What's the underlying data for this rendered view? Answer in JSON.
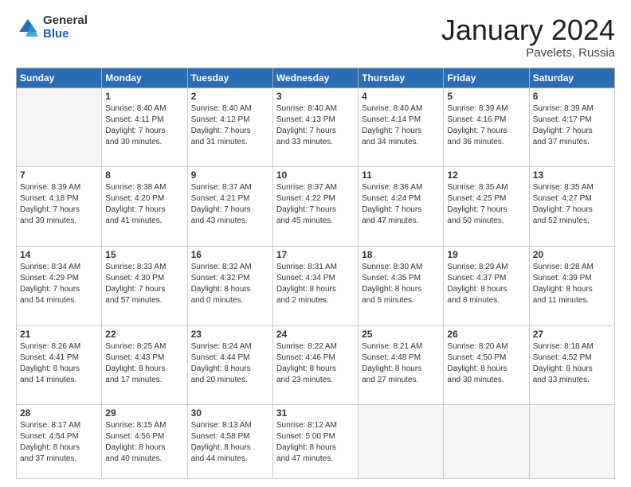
{
  "logo": {
    "general": "General",
    "blue": "Blue"
  },
  "title": "January 2024",
  "location": "Pavelets, Russia",
  "days_header": [
    "Sunday",
    "Monday",
    "Tuesday",
    "Wednesday",
    "Thursday",
    "Friday",
    "Saturday"
  ],
  "weeks": [
    [
      {
        "day": "",
        "content": ""
      },
      {
        "day": "1",
        "content": "Sunrise: 8:40 AM\nSunset: 4:11 PM\nDaylight: 7 hours\nand 30 minutes."
      },
      {
        "day": "2",
        "content": "Sunrise: 8:40 AM\nSunset: 4:12 PM\nDaylight: 7 hours\nand 31 minutes."
      },
      {
        "day": "3",
        "content": "Sunrise: 8:40 AM\nSunset: 4:13 PM\nDaylight: 7 hours\nand 33 minutes."
      },
      {
        "day": "4",
        "content": "Sunrise: 8:40 AM\nSunset: 4:14 PM\nDaylight: 7 hours\nand 34 minutes."
      },
      {
        "day": "5",
        "content": "Sunrise: 8:39 AM\nSunset: 4:16 PM\nDaylight: 7 hours\nand 36 minutes."
      },
      {
        "day": "6",
        "content": "Sunrise: 8:39 AM\nSunset: 4:17 PM\nDaylight: 7 hours\nand 37 minutes."
      }
    ],
    [
      {
        "day": "7",
        "content": "Sunrise: 8:39 AM\nSunset: 4:18 PM\nDaylight: 7 hours\nand 39 minutes."
      },
      {
        "day": "8",
        "content": "Sunrise: 8:38 AM\nSunset: 4:20 PM\nDaylight: 7 hours\nand 41 minutes."
      },
      {
        "day": "9",
        "content": "Sunrise: 8:37 AM\nSunset: 4:21 PM\nDaylight: 7 hours\nand 43 minutes."
      },
      {
        "day": "10",
        "content": "Sunrise: 8:37 AM\nSunset: 4:22 PM\nDaylight: 7 hours\nand 45 minutes."
      },
      {
        "day": "11",
        "content": "Sunrise: 8:36 AM\nSunset: 4:24 PM\nDaylight: 7 hours\nand 47 minutes."
      },
      {
        "day": "12",
        "content": "Sunrise: 8:35 AM\nSunset: 4:25 PM\nDaylight: 7 hours\nand 50 minutes."
      },
      {
        "day": "13",
        "content": "Sunrise: 8:35 AM\nSunset: 4:27 PM\nDaylight: 7 hours\nand 52 minutes."
      }
    ],
    [
      {
        "day": "14",
        "content": "Sunrise: 8:34 AM\nSunset: 4:29 PM\nDaylight: 7 hours\nand 54 minutes."
      },
      {
        "day": "15",
        "content": "Sunrise: 8:33 AM\nSunset: 4:30 PM\nDaylight: 7 hours\nand 57 minutes."
      },
      {
        "day": "16",
        "content": "Sunrise: 8:32 AM\nSunset: 4:32 PM\nDaylight: 8 hours\nand 0 minutes."
      },
      {
        "day": "17",
        "content": "Sunrise: 8:31 AM\nSunset: 4:34 PM\nDaylight: 8 hours\nand 2 minutes."
      },
      {
        "day": "18",
        "content": "Sunrise: 8:30 AM\nSunset: 4:35 PM\nDaylight: 8 hours\nand 5 minutes."
      },
      {
        "day": "19",
        "content": "Sunrise: 8:29 AM\nSunset: 4:37 PM\nDaylight: 8 hours\nand 8 minutes."
      },
      {
        "day": "20",
        "content": "Sunrise: 8:28 AM\nSunset: 4:39 PM\nDaylight: 8 hours\nand 11 minutes."
      }
    ],
    [
      {
        "day": "21",
        "content": "Sunrise: 8:26 AM\nSunset: 4:41 PM\nDaylight: 8 hours\nand 14 minutes."
      },
      {
        "day": "22",
        "content": "Sunrise: 8:25 AM\nSunset: 4:43 PM\nDaylight: 8 hours\nand 17 minutes."
      },
      {
        "day": "23",
        "content": "Sunrise: 8:24 AM\nSunset: 4:44 PM\nDaylight: 8 hours\nand 20 minutes."
      },
      {
        "day": "24",
        "content": "Sunrise: 8:22 AM\nSunset: 4:46 PM\nDaylight: 8 hours\nand 23 minutes."
      },
      {
        "day": "25",
        "content": "Sunrise: 8:21 AM\nSunset: 4:48 PM\nDaylight: 8 hours\nand 27 minutes."
      },
      {
        "day": "26",
        "content": "Sunrise: 8:20 AM\nSunset: 4:50 PM\nDaylight: 8 hours\nand 30 minutes."
      },
      {
        "day": "27",
        "content": "Sunrise: 8:18 AM\nSunset: 4:52 PM\nDaylight: 8 hours\nand 33 minutes."
      }
    ],
    [
      {
        "day": "28",
        "content": "Sunrise: 8:17 AM\nSunset: 4:54 PM\nDaylight: 8 hours\nand 37 minutes."
      },
      {
        "day": "29",
        "content": "Sunrise: 8:15 AM\nSunset: 4:56 PM\nDaylight: 8 hours\nand 40 minutes."
      },
      {
        "day": "30",
        "content": "Sunrise: 8:13 AM\nSunset: 4:58 PM\nDaylight: 8 hours\nand 44 minutes."
      },
      {
        "day": "31",
        "content": "Sunrise: 8:12 AM\nSunset: 5:00 PM\nDaylight: 8 hours\nand 47 minutes."
      },
      {
        "day": "",
        "content": ""
      },
      {
        "day": "",
        "content": ""
      },
      {
        "day": "",
        "content": ""
      }
    ]
  ]
}
